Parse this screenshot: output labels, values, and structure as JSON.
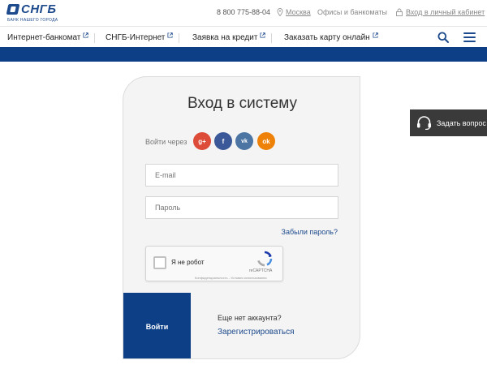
{
  "brand": {
    "name": "СНГБ",
    "tagline": "БАНК НАШЕГО ГОРОДА",
    "color": "#1d4a8c"
  },
  "topbar": {
    "phone": "8 800 775-88-04",
    "city": "Москва",
    "offices": "Офисы и банкоматы",
    "cabinet": "Вход в личный кабинет"
  },
  "nav": {
    "items": [
      {
        "label": "Интернет-банкомат",
        "icon": "external-link-icon"
      },
      {
        "label": "СНГБ-Интернет",
        "icon": "external-link-icon"
      },
      {
        "label": "Заявка на кредит",
        "icon": "external-link-icon"
      },
      {
        "label": "Заказать карту онлайн",
        "icon": "external-link-icon"
      }
    ],
    "search_icon": "search-icon",
    "menu_icon": "hamburger-icon"
  },
  "login": {
    "title": "Вход в систему",
    "social_label": "Войти через",
    "social": [
      {
        "label": "g+",
        "icon": "google-plus-icon",
        "color": "#dd4b39"
      },
      {
        "label": "f",
        "icon": "facebook-icon",
        "color": "#3b5998"
      },
      {
        "label": "vk",
        "icon": "vk-icon",
        "color": "#4c75a3"
      },
      {
        "label": "ok",
        "icon": "odnoklassniki-icon",
        "color": "#ee8208"
      }
    ],
    "email_placeholder": "E-mail",
    "password_placeholder": "Пароль",
    "forgot": "Забыли пароль?",
    "captcha": {
      "label": "Я не робот",
      "brand": "reCAPTCHA",
      "links": "Конфиденциальность - Условия использования"
    },
    "submit": "Войти",
    "no_account": "Еще нет аккаунта?",
    "register": "Зарегистрироваться"
  },
  "ask": {
    "label": "Задать вопрос",
    "icon": "headset-icon"
  },
  "colors": {
    "primary": "#0d3f86",
    "card_bg": "#f4f4f4",
    "ask_bg": "#3a3a3a"
  }
}
